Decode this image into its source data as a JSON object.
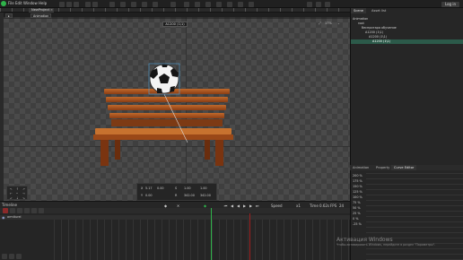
{
  "menu": [
    "File",
    "Edit",
    "Window",
    "Help"
  ],
  "document_tab": "NewProject",
  "login_label": "Log in",
  "canvas": {
    "mode_buttons": [
      "Animation"
    ],
    "camera_label": "А1200 (1\\1)",
    "zoom_label": "17%"
  },
  "right_panel": {
    "tabs": [
      "Scene",
      "Asset list"
    ],
    "tree": [
      {
        "label": "Animation"
      },
      {
        "label": "root"
      },
      {
        "label": "беспритара обучение"
      },
      {
        "label": "А1200 (1\\1)"
      },
      {
        "label": "А1200 (1\\1)"
      },
      {
        "label": "А1200 (1\\1)"
      }
    ],
    "lower_tabs": [
      "Animation",
      "Property",
      "Curve Editor"
    ],
    "percent_labels": [
      "200 %",
      "175 %",
      "150 %",
      "125 %",
      "100 %",
      "75 %",
      "50 %",
      "25 %",
      "0 %",
      "-25 %"
    ]
  },
  "position_box": {
    "rows": [
      [
        "X",
        "5.17",
        "0.00",
        "S",
        "1.00"
      ],
      [
        "Y",
        "0.00",
        "",
        "R",
        "342.00"
      ]
    ]
  },
  "nav_pad": {
    "cells": [
      "↖",
      "↑",
      "↗",
      "←",
      "•",
      "→",
      "↙",
      "↓",
      "↘"
    ]
  },
  "playback": {
    "speed_label": "Speed",
    "speed_value": "x1",
    "time_label": "Time",
    "time_value": "0.62s",
    "fps_label": "FPS",
    "fps_value": "24",
    "buttons": [
      "⏮",
      "◀",
      "◀",
      "▶",
      "▶",
      "⏭"
    ]
  },
  "timeline": {
    "title": "Timeline",
    "track_name": "armiturel"
  },
  "watermark": {
    "line1": "Активация Windows",
    "line2": "Чтобы активировать Windows, перейдите в раздел \"Параметры\"."
  },
  "colors": {
    "accent": "#2fb34a",
    "selection": "#2c5a4a",
    "keyframe": "#a02020"
  }
}
